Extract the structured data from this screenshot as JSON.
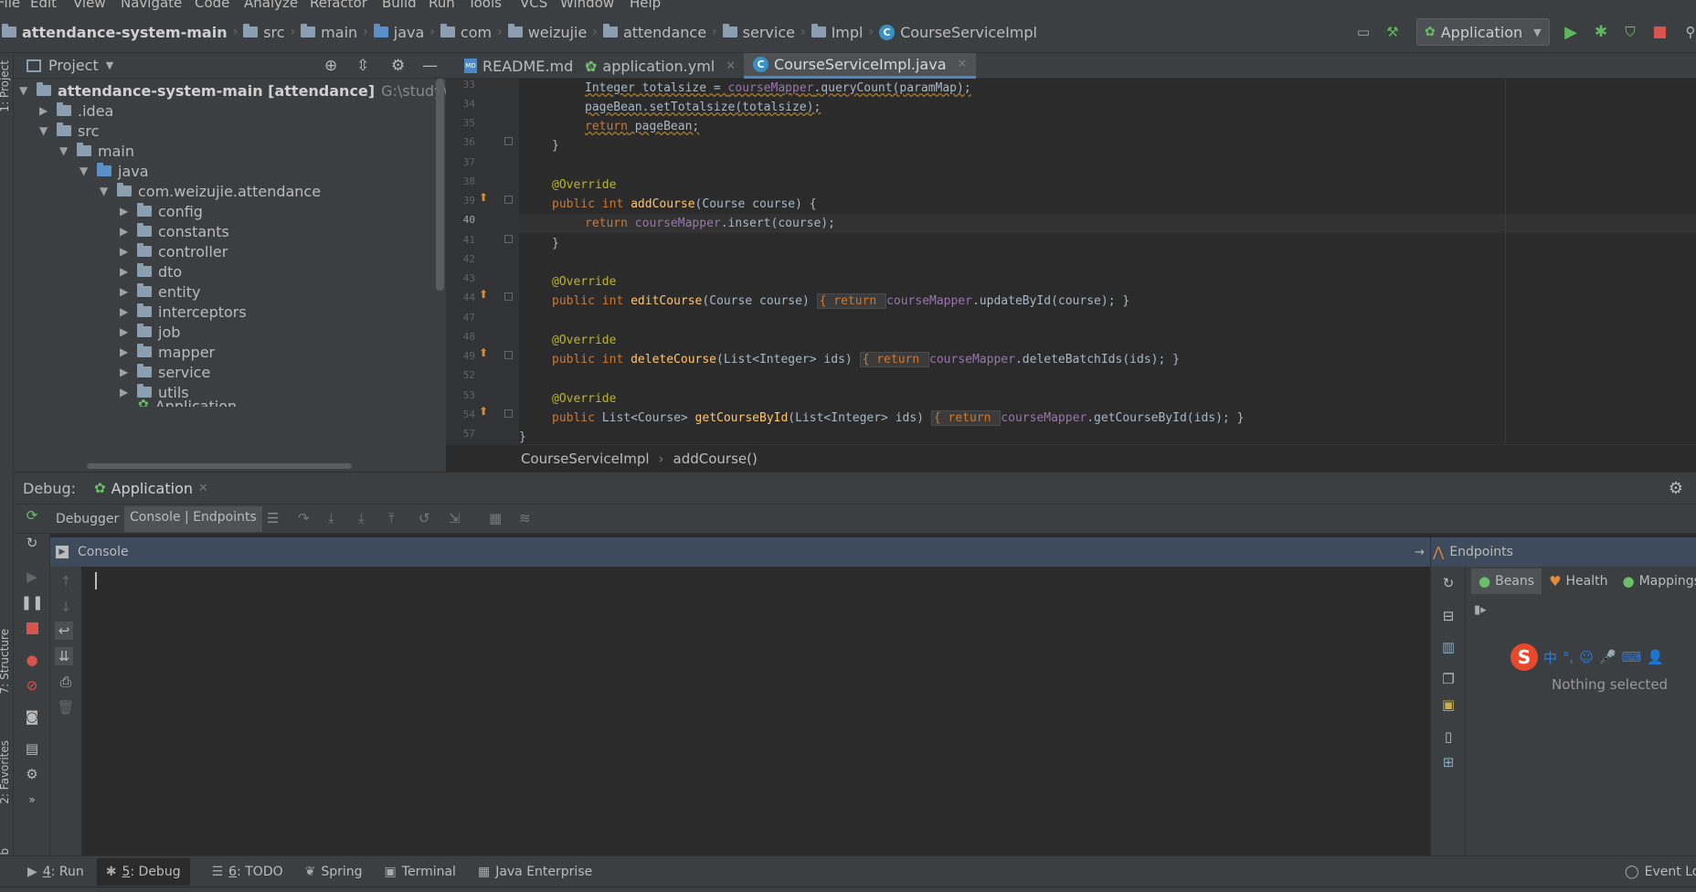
{
  "menu": [
    "File",
    "Edit",
    "View",
    "Navigate",
    "Code",
    "Analyze",
    "Refactor",
    "Build",
    "Run",
    "Tools",
    "VCS",
    "Window",
    "Help"
  ],
  "nav": {
    "crumbs": [
      "attendance-system-main",
      "src",
      "main",
      "java",
      "com",
      "weizujie",
      "attendance",
      "service",
      "Impl",
      "CourseServiceImpl"
    ],
    "run_config": "Application"
  },
  "strip": {
    "project": "1: Project",
    "structure": "7: Structure",
    "favorites": "2: Favorites",
    "web": "Web"
  },
  "project": {
    "title": "Project",
    "root_name": "attendance-system-main [attendance]",
    "root_path": "G:\\study\\attendance",
    "items": [
      ".idea",
      "src",
      "main",
      "java",
      "com.weizujie.attendance",
      "config",
      "constants",
      "controller",
      "dto",
      "entity",
      "interceptors",
      "job",
      "mapper",
      "service",
      "utils",
      "Application"
    ]
  },
  "editor": {
    "tabs": [
      "README.md",
      "application.yml",
      "CourseServiceImpl.java"
    ],
    "line_numbers": [
      "33",
      "34",
      "35",
      "36",
      "37",
      "38",
      "39",
      "40",
      "41",
      "42",
      "43",
      "44",
      "47",
      "48",
      "49",
      "52",
      "53",
      "54",
      "57"
    ],
    "crumb_class": "CourseServiceImpl",
    "crumb_method": "addCourse()"
  },
  "code": {
    "l33": [
      "Integer totalsize = ",
      "courseMapper",
      ".queryCount(paramMap);"
    ],
    "l34": "pageBean.setTotalsize(totalsize);",
    "l35": [
      "return",
      " pageBean;"
    ],
    "close": "}",
    "override": "@Override",
    "l39": [
      "public int ",
      "addCourse",
      "(Course course) {"
    ],
    "l40": [
      "return ",
      "courseMapper",
      ".insert(course);"
    ],
    "l44": [
      "public int ",
      "editCourse",
      "(Course course) ",
      "{ return ",
      "courseMapper",
      ".updateById(course); }"
    ],
    "l49": [
      "public int ",
      "deleteCourse",
      "(List<Integer> ids) ",
      "{ return ",
      "courseMapper",
      ".deleteBatchIds(ids); }"
    ],
    "l54": [
      "public ",
      "List<Course> ",
      "getCourseById",
      "(List<Integer> ids) ",
      "{ return ",
      "courseMapper",
      ".getCourseById(ids); }"
    ]
  },
  "debug": {
    "label": "Debug:",
    "config": "Application",
    "tab_debugger": "Debugger",
    "tab_console": "Console | Endpoints",
    "console_title": "Console",
    "endpoints_title": "Endpoints",
    "endpoint_tabs": [
      "Beans",
      "Health",
      "Mappings"
    ],
    "nothing_selected": "Nothing selected",
    "ime": [
      "中",
      "°,",
      "☺",
      "🎤",
      "⌨",
      "👤"
    ]
  },
  "bottom": {
    "run": [
      "4",
      ": Run"
    ],
    "debug": [
      "5",
      ": Debug"
    ],
    "todo": [
      "6",
      ": TODO"
    ],
    "spring": "Spring",
    "terminal": "Terminal",
    "java_enterprise": "Java Enterprise",
    "event_log": "Event Log"
  }
}
